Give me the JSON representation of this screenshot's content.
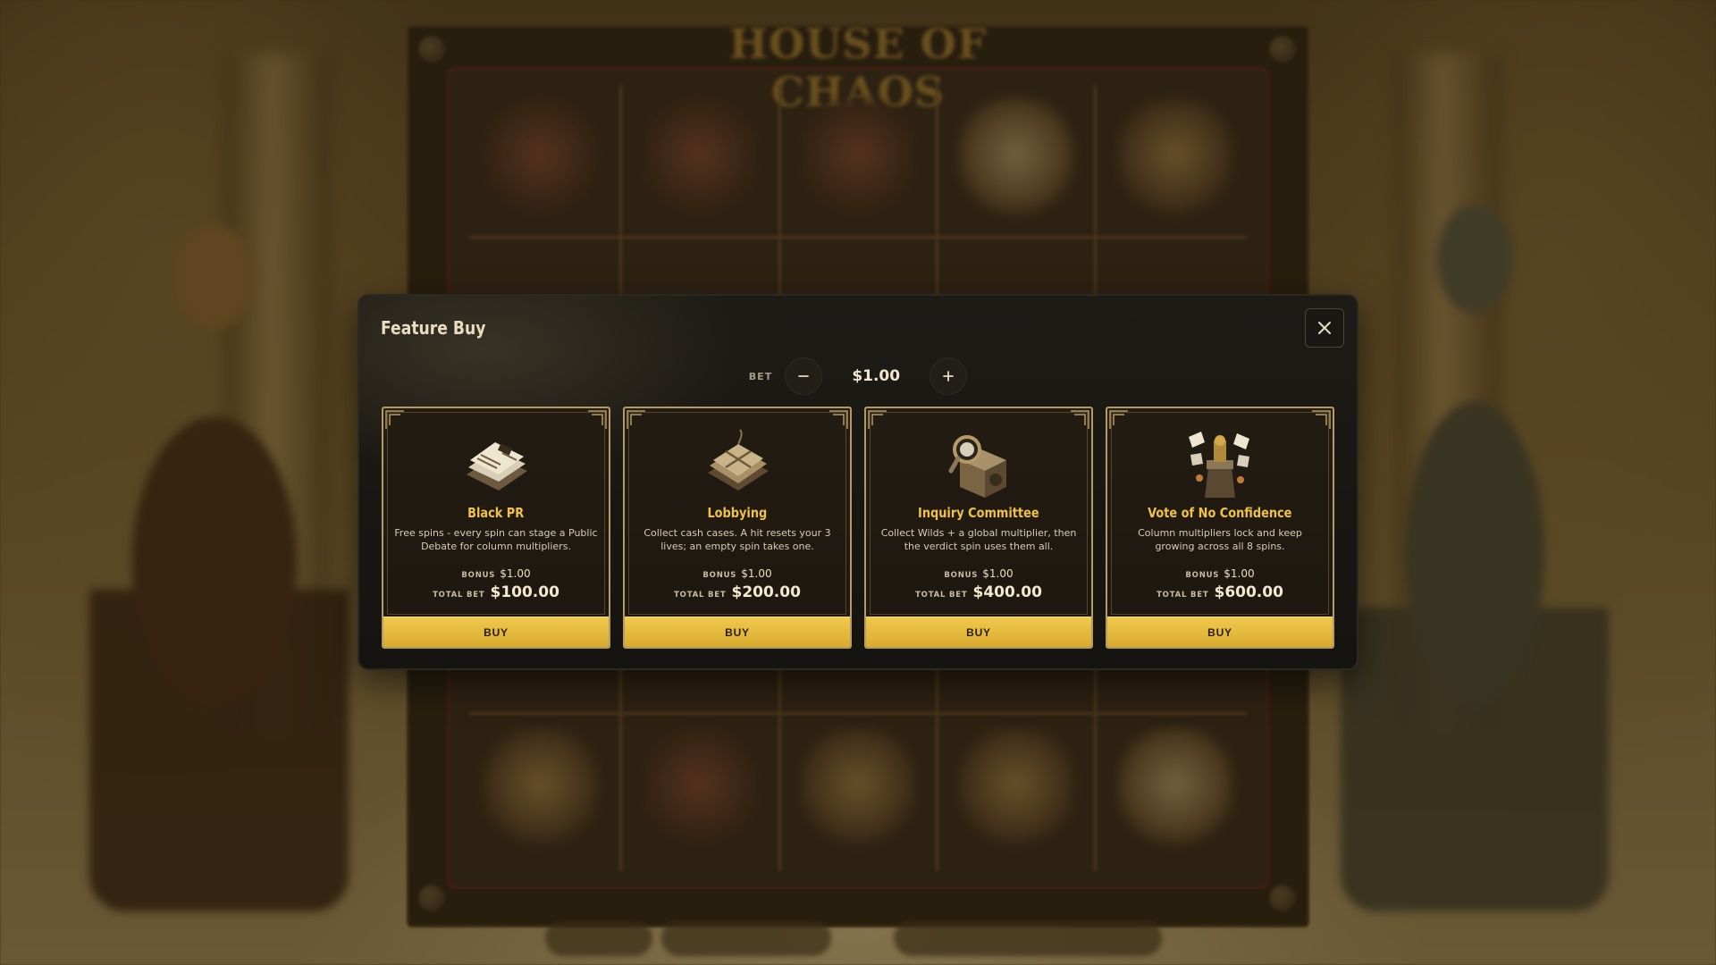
{
  "game": {
    "title": "HOUSE OF CHAOS"
  },
  "modal": {
    "title": "Feature Buy",
    "close_icon": "close-icon",
    "bet": {
      "label": "BET",
      "value": "$1.00",
      "decrease_icon": "minus-icon",
      "increase_icon": "plus-icon"
    },
    "labels": {
      "bonus": "BONUS",
      "total_bet": "TOTAL BET",
      "buy": "BUY"
    },
    "features": [
      {
        "name": "Black PR",
        "icon": "newspaper-stack-icon",
        "description": "Free spins - every spin can stage a Public Debate for column multipliers.",
        "bonus": "$1.00",
        "total_bet": "$100.00"
      },
      {
        "name": "Lobbying",
        "icon": "cash-bundle-icon",
        "description": "Collect cash cases. A hit resets your 3 lives; an empty spin takes one.",
        "bonus": "$1.00",
        "total_bet": "$200.00"
      },
      {
        "name": "Inquiry Committee",
        "icon": "magnifier-box-icon",
        "description": "Collect Wilds + a global multiplier, then the verdict spin uses them all.",
        "bonus": "$1.00",
        "total_bet": "$400.00"
      },
      {
        "name": "Vote of No Confidence",
        "icon": "ballot-podium-icon",
        "description": "Column multipliers lock and keep growing across all 8 spins.",
        "bonus": "$1.00",
        "total_bet": "$600.00"
      }
    ]
  },
  "colors": {
    "accent_gold": "#f0c24a",
    "button_gold": "#e3b53a",
    "modal_bg": "#1a1814",
    "card_border": "#b49a63"
  }
}
